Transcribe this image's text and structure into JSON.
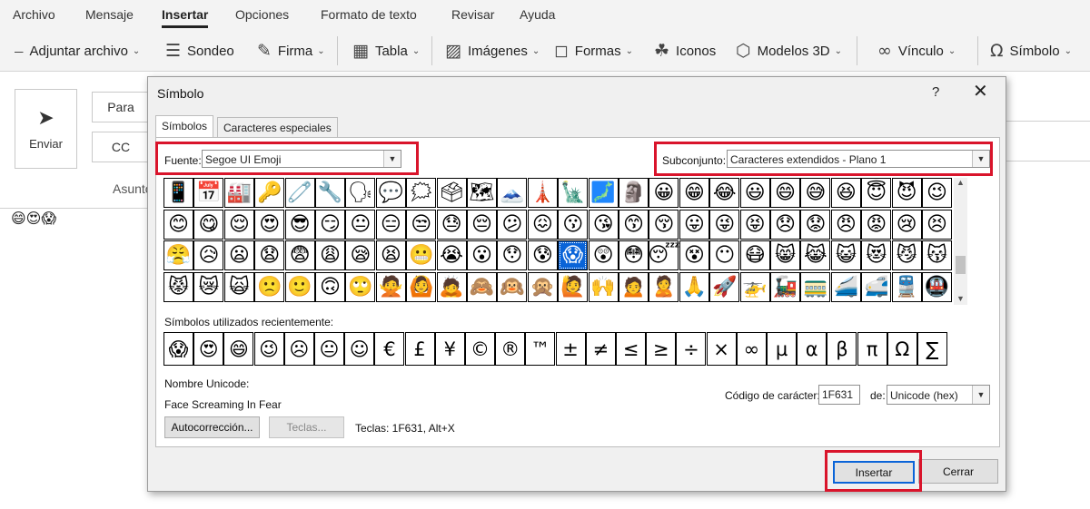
{
  "ribbon": {
    "tabs": [
      {
        "label": "Archivo"
      },
      {
        "label": "Mensaje"
      },
      {
        "label": "Insertar"
      },
      {
        "label": "Opciones"
      },
      {
        "label": "Formato de texto"
      },
      {
        "label": "Revisar"
      },
      {
        "label": "Ayuda"
      }
    ],
    "active_tab": "Insertar",
    "commands": [
      {
        "label": "Adjuntar archivo",
        "icon": "paperclip-icon",
        "glyph": "⎯"
      },
      {
        "label": "Sondeo",
        "icon": "poll-icon",
        "glyph": "☰"
      },
      {
        "label": "Firma",
        "icon": "signature-icon",
        "glyph": "✎"
      },
      {
        "label": "Tabla",
        "icon": "table-icon",
        "glyph": "▦"
      },
      {
        "label": "Imágenes",
        "icon": "pictures-icon",
        "glyph": "▨"
      },
      {
        "label": "Formas",
        "icon": "shapes-icon",
        "glyph": "◻"
      },
      {
        "label": "Iconos",
        "icon": "icons-icon",
        "glyph": "☘"
      },
      {
        "label": "Modelos 3D",
        "icon": "cube-icon",
        "glyph": "⬡"
      },
      {
        "label": "Vínculo",
        "icon": "link-icon",
        "glyph": "∞"
      },
      {
        "label": "Símbolo",
        "icon": "omega-icon",
        "glyph": "Ω"
      }
    ]
  },
  "mail": {
    "send_label": "Enviar",
    "to_label": "Para",
    "cc_label": "CC",
    "subject_label": "Asunto",
    "body_emojis": "😄😍😱"
  },
  "dialog": {
    "title": "Símbolo",
    "help": "?",
    "close": "✕",
    "tabs": [
      {
        "label": "Símbolos"
      },
      {
        "label": "Caracteres especiales"
      }
    ],
    "font_label": "Fuente:",
    "font_value": "Segoe UI Emoji",
    "subset_label": "Subconjunto:",
    "subset_value": "Caracteres extendidos - Plano 1",
    "symbol_rows": [
      [
        "📱",
        "📅",
        "🏭",
        "🔑",
        "🧷",
        "🔧",
        "🗣",
        "💬",
        "🗯",
        "🗳",
        "🗺",
        "🗻",
        "🗼",
        "🗽",
        "🗾",
        "🗿",
        "😀",
        "😁",
        "😂",
        "😃",
        "😄",
        "😅",
        "😆",
        "😇",
        "😈",
        "😉"
      ],
      [
        "😊",
        "😋",
        "😌",
        "😍",
        "😎",
        "😏",
        "😐",
        "😑",
        "😒",
        "😓",
        "😔",
        "😕",
        "😖",
        "😗",
        "😘",
        "😙",
        "😚",
        "😛",
        "😜",
        "😝",
        "😞",
        "😟",
        "😠",
        "😡",
        "😢",
        "😣"
      ],
      [
        "😤",
        "😥",
        "😦",
        "😧",
        "😨",
        "😩",
        "😪",
        "😫",
        "😬",
        "😭",
        "😮",
        "😯",
        "😰",
        "😱",
        "😲",
        "😳",
        "😴",
        "😵",
        "😶",
        "😷",
        "😸",
        "😹",
        "😺",
        "😻",
        "😼",
        "😽"
      ],
      [
        "😾",
        "😿",
        "🙀",
        "🙁",
        "🙂",
        "🙃",
        "🙄",
        "🙅",
        "🙆",
        "🙇",
        "🙈",
        "🙉",
        "🙊",
        "🙋",
        "🙌",
        "🙍",
        "🙎",
        "🙏",
        "🚀",
        "🚁",
        "🚂",
        "🚃",
        "🚄",
        "🚅",
        "🚆",
        "🚇"
      ]
    ],
    "selected_symbol": "😱",
    "recent_label": "Símbolos utilizados recientemente:",
    "recent_symbols": [
      "😱",
      "😍",
      "😄",
      "😉",
      "☹",
      "😐",
      "☺",
      "€",
      "£",
      "¥",
      "©",
      "®",
      "™",
      "±",
      "≠",
      "≤",
      "≥",
      "÷",
      "×",
      "∞",
      "µ",
      "α",
      "β",
      "π",
      "Ω",
      "∑"
    ],
    "unicode_name_label": "Nombre Unicode:",
    "unicode_name_value": "Face Screaming In Fear",
    "char_code_label": "Código de carácter:",
    "char_code_value": "1F631",
    "from_label": "de:",
    "from_value": "Unicode (hex)",
    "autocorrect_label": "Autocorrección...",
    "keys_button_label": "Teclas...",
    "shortcut_text": "Teclas: 1F631, Alt+X",
    "insert_label": "Insertar",
    "cancel_label": "Cerrar"
  },
  "colors": {
    "highlight": "#d9142b",
    "selection": "#0a64d8"
  }
}
